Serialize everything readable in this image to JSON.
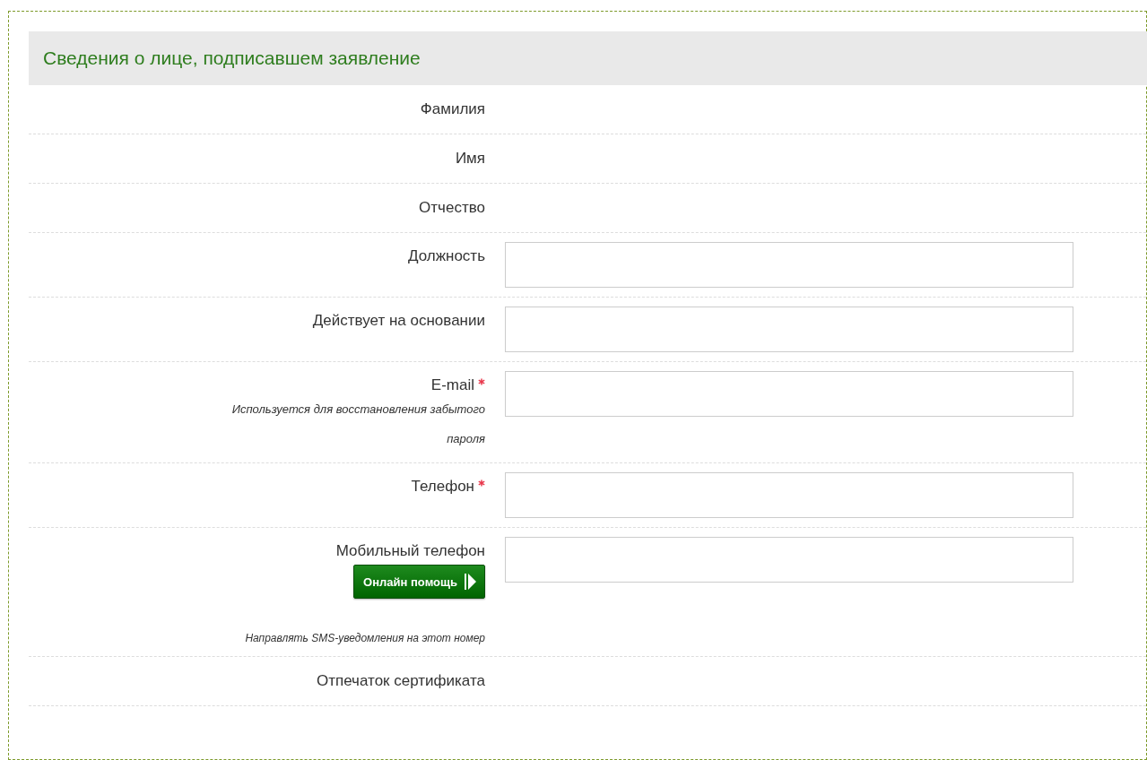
{
  "section": {
    "title": "Сведения о лице, подписавшем заявление"
  },
  "rows": [
    {
      "kind": "static",
      "label": "Фамилия"
    },
    {
      "kind": "static",
      "label": "Имя"
    },
    {
      "kind": "static",
      "label": "Отчество"
    },
    {
      "kind": "input",
      "label": "Должность"
    },
    {
      "kind": "input",
      "label": "Действует на основании"
    },
    {
      "kind": "input",
      "label": "E-mail",
      "required": true,
      "hint": "Используется для восстановления забытого пароля"
    },
    {
      "kind": "input",
      "label": "Телефон",
      "required": true
    },
    {
      "kind": "input",
      "label": "Мобильный телефон",
      "help_button": "Онлайн помощь",
      "hint": "Направлять SMS-уведомления на этот номер"
    },
    {
      "kind": "static",
      "label": "Отпечаток сертификата"
    }
  ]
}
